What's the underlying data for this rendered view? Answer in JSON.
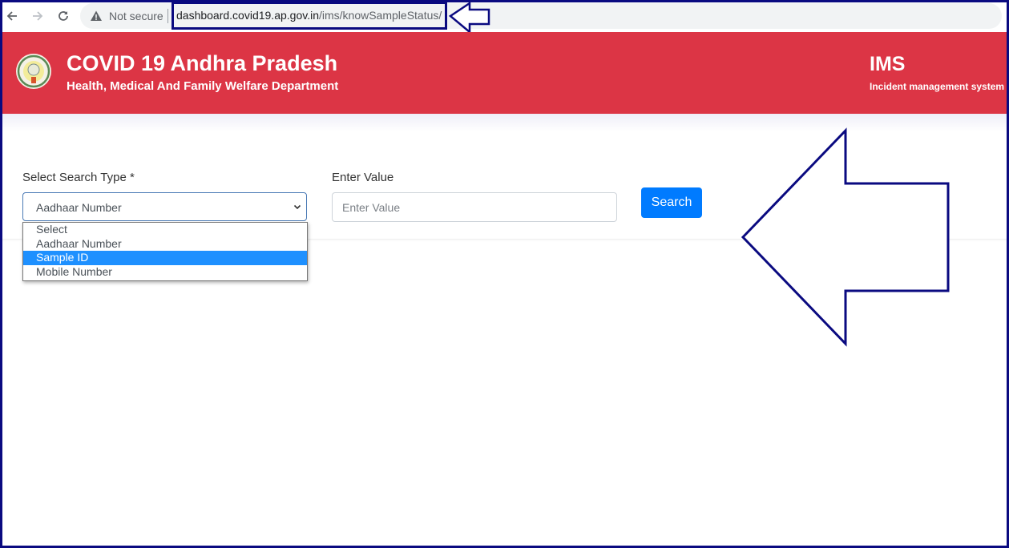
{
  "browser": {
    "back_icon": "arrow-left-icon",
    "forward_icon": "arrow-right-icon",
    "reload_icon": "reload-icon",
    "security_icon": "warning-triangle-icon",
    "security_label": "Not secure",
    "url_domain": "dashboard.covid19.ap.gov.in",
    "url_path": "/ims/knowSampleStatus/"
  },
  "header": {
    "logo": "andhra-pradesh-emblem",
    "title": "COVID 19 Andhra Pradesh",
    "subtitle": "Health, Medical And Family Welfare Department",
    "app_title": "IMS",
    "app_subtitle": "Incident management system"
  },
  "form": {
    "search_type_label": "Select Search Type *",
    "search_type_value": "Aadhaar Number",
    "search_type_options": [
      "Select",
      "Aadhaar Number",
      "Sample ID",
      "Mobile Number"
    ],
    "highlighted_option": "Sample ID",
    "value_label": "Enter Value",
    "value_placeholder": "Enter Value",
    "value": "",
    "search_button": "Search"
  },
  "colors": {
    "header_bg": "#dc3545",
    "button_bg": "#007bff",
    "highlight_option_bg": "#1e90ff",
    "annotation": "#0a0a80"
  }
}
